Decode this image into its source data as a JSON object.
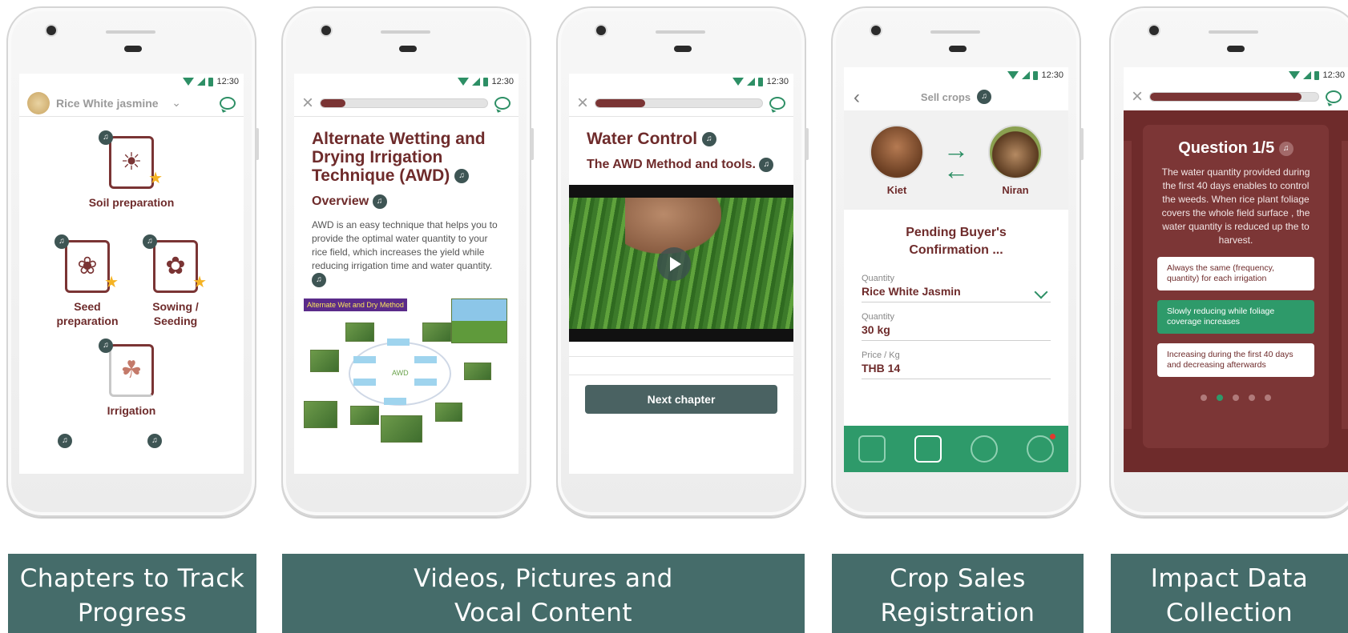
{
  "status": {
    "time": "12:30"
  },
  "phone1": {
    "crop_name": "Rice White jasmine",
    "chapters": [
      {
        "label": "Soil preparation",
        "icon": "soil-icon"
      },
      {
        "label": "Seed preparation",
        "icon": "seed-icon"
      },
      {
        "label": "Sowing / Seeding",
        "icon": "seeding-icon"
      },
      {
        "label": "Irrigation",
        "icon": "watering-can-icon"
      }
    ]
  },
  "phone2": {
    "title": "Alternate Wetting and Drying Irrigation Technique (AWD)",
    "overview_heading": "Overview",
    "overview_text": "AWD is an easy technique that helps you to provide the optimal water quantity to your rice field, which increases the yield while reducing irrigation time and water quantity.",
    "diagram_tag": "Alternate Wet and Dry Method",
    "diagram_center": "AWD",
    "progress": 0.15
  },
  "phone3": {
    "title": "Water Control",
    "subtitle": "The AWD Method and tools.",
    "next_button": "Next chapter",
    "progress": 0.3
  },
  "phone4": {
    "title": "Sell crops",
    "seller": "Kiet",
    "buyer": "Niran",
    "status": "Pending Buyer's Confirmation ...",
    "fields": [
      {
        "label": "Quantity",
        "value": "Rice White Jasmin"
      },
      {
        "label": "Quantity",
        "value": "30 kg"
      },
      {
        "label": "Price / Kg",
        "value": "THB 14"
      }
    ]
  },
  "phone5": {
    "question_title": "Question 1/5",
    "question_text": "The water quantity provided during the first 40 days enables to control the weeds. When rice plant foliage covers the whole field surface , the water quantity is reduced up the to harvest.",
    "answers": [
      "Always the same (frequency, quantity) for each irrigation",
      "Slowly reducing while foliage coverage increases",
      "Increasing during the first 40 days and decreasing afterwards"
    ],
    "selected_answer": 1,
    "progress": 0.9,
    "page_count": 5,
    "current_page": 2
  },
  "captions": [
    "Chapters to Track Progress",
    "Videos, Pictures and Vocal Content",
    "Crop Sales Registration",
    "Impact Data Collection"
  ],
  "colors": {
    "maroon": "#6e2b2b",
    "green": "#2e9a6a",
    "banner": "#456c6a"
  }
}
